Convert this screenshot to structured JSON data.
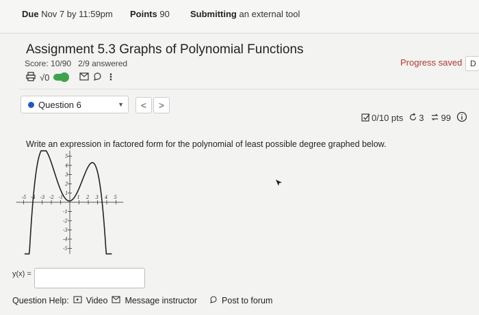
{
  "header": {
    "due_label": "Due",
    "due_value": "Nov 7 by 11:59pm",
    "points_label": "Points",
    "points_value": "90",
    "submitting_label": "Submitting",
    "submitting_value": "an external tool"
  },
  "assignment": {
    "title": "Assignment 5.3 Graphs of Polynomial Functions",
    "score": "Score: 10/90",
    "answered": "2/9 answered",
    "progress_status": "Progress saved",
    "done_button": "D"
  },
  "toolbar": {
    "sqrt_label": "√0"
  },
  "question_nav": {
    "selected_question": "Question 6",
    "prev": "<",
    "next": ">"
  },
  "question_stats": {
    "points": "0/10 pts",
    "retries": "3",
    "attempts": "99"
  },
  "question": {
    "prompt": "Write an expression in factored form for the polynomial of least possible degree graphed below.",
    "answer_label": "y(x) =",
    "answer_value": ""
  },
  "graph": {
    "x_ticks": [
      "-5",
      "-4",
      "-3",
      "-2",
      "-1",
      "1",
      "2",
      "3",
      "4",
      "5"
    ],
    "y_ticks": [
      "5",
      "4",
      "3",
      "2",
      "1",
      "-1",
      "-2",
      "-3",
      "-4",
      "-5"
    ]
  },
  "help": {
    "label": "Question Help:",
    "video": "Video",
    "message": "Message instructor",
    "post": "Post to forum"
  },
  "colors": {
    "progress": "#b03a2e",
    "toggle": "#3fa34d",
    "question_dot": "#1f57c8"
  }
}
